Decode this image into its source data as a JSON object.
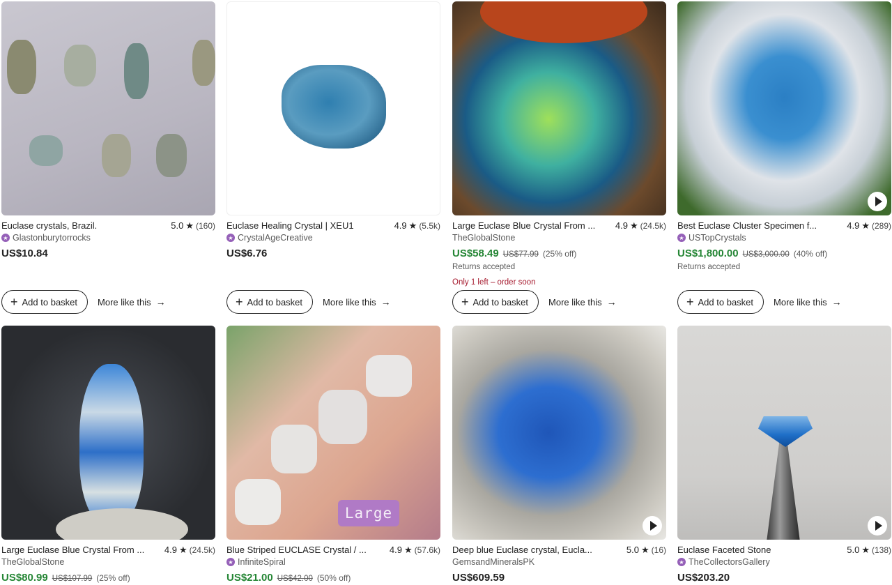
{
  "labels": {
    "add_to_basket": "Add to basket",
    "more_like_this": "More like this"
  },
  "listings": [
    {
      "title": "Euclase crystals, Brazil.",
      "rating": "5.0",
      "reviews": "(160)",
      "shop": "Glastonburytorrocks",
      "star_seller": true,
      "price": "US$10.84",
      "original_price": "",
      "discount": "",
      "returns": "",
      "scarcity": "",
      "video": false
    },
    {
      "title": "Euclase Healing Crystal | XEU1",
      "rating": "4.9",
      "reviews": "(5.5k)",
      "shop": "CrystalAgeCreative",
      "star_seller": true,
      "price": "US$6.76",
      "original_price": "",
      "discount": "",
      "returns": "",
      "scarcity": "",
      "video": false
    },
    {
      "title": "Large Euclase Blue Crystal From ...",
      "rating": "4.9",
      "reviews": "(24.5k)",
      "shop": "TheGlobalStone",
      "star_seller": false,
      "price": "US$58.49",
      "original_price": "US$77.99",
      "discount": "(25% off)",
      "returns": "Returns accepted",
      "scarcity": "Only 1 left – order soon",
      "video": false
    },
    {
      "title": "Best Euclase Cluster Specimen f...",
      "rating": "4.9",
      "reviews": "(289)",
      "shop": "USTopCrystals",
      "star_seller": true,
      "price": "US$1,800.00",
      "original_price": "US$3,000.00",
      "discount": "(40% off)",
      "returns": "Returns accepted",
      "scarcity": "",
      "video": true
    },
    {
      "title": "Large Euclase Blue Crystal From ...",
      "rating": "4.9",
      "reviews": "(24.5k)",
      "shop": "TheGlobalStone",
      "star_seller": false,
      "price": "US$80.99",
      "original_price": "US$107.99",
      "discount": "(25% off)",
      "returns": "",
      "scarcity": "",
      "video": false
    },
    {
      "title": "Blue Striped EUCLASE Crystal / ...",
      "rating": "4.9",
      "reviews": "(57.6k)",
      "shop": "InfiniteSpiral",
      "star_seller": true,
      "price": "US$21.00",
      "original_price": "US$42.00",
      "discount": "(50% off)",
      "returns": "",
      "scarcity": "",
      "video": false,
      "image_text": "Large"
    },
    {
      "title": "Deep blue Euclase crystal, Eucla...",
      "rating": "5.0",
      "reviews": "(16)",
      "shop": "GemsandMineralsPK",
      "star_seller": false,
      "price": "US$609.59",
      "original_price": "",
      "discount": "",
      "returns": "",
      "scarcity": "",
      "video": true
    },
    {
      "title": "Euclase Faceted Stone",
      "rating": "5.0",
      "reviews": "(138)",
      "shop": "TheCollectorsGallery",
      "star_seller": true,
      "price": "US$203.20",
      "original_price": "",
      "discount": "",
      "returns": "",
      "scarcity": "",
      "video": true
    }
  ],
  "colors": {
    "sale_price": "#258635",
    "scarcity": "#a61a2e",
    "star_seller_badge": "#9560b8"
  }
}
